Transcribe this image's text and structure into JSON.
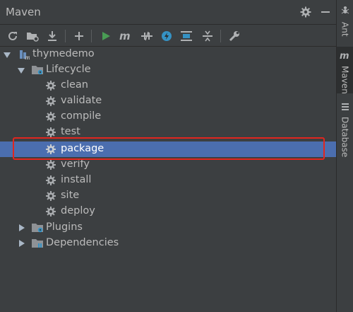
{
  "panel": {
    "title": "Maven",
    "header_icons": [
      "gear-icon",
      "minimize-icon"
    ]
  },
  "toolbar": {
    "buttons": [
      "reload-icon",
      "add-folder-icon",
      "download-icon",
      "add-icon",
      "run-icon",
      "maven-goal-icon",
      "toggle-offline-icon",
      "skip-tests-icon",
      "show-dependencies-icon",
      "collapse-all-icon",
      "settings-wrench-icon"
    ]
  },
  "tree": {
    "project": "thymedemo",
    "lifecycle": "Lifecycle",
    "goals": [
      "clean",
      "validate",
      "compile",
      "test",
      "package",
      "verify",
      "install",
      "site",
      "deploy"
    ],
    "selected_goal": "package",
    "plugins": "Plugins",
    "dependencies": "Dependencies"
  },
  "right_sidebar": {
    "tabs": [
      "Ant",
      "Maven",
      "Database"
    ],
    "active_tab": "Maven"
  },
  "colors": {
    "background": "#3c3f41",
    "selection": "#4b6eaf",
    "annotation_box": "#e0261f",
    "run_green": "#499c54",
    "accent_blue": "#3592c4"
  }
}
